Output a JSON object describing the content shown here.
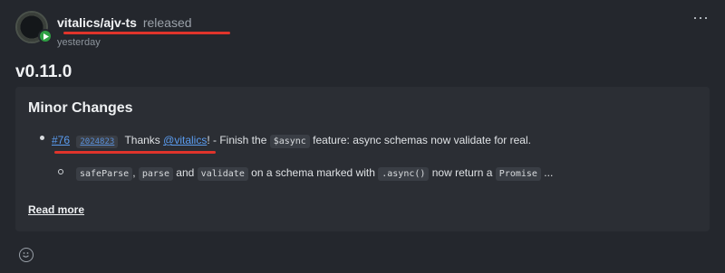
{
  "release": {
    "repo": "vitalics/ajv-ts",
    "action": "released",
    "time": "yesterday",
    "version": "v0.11.0"
  },
  "changelog": {
    "section_title": "Minor Changes",
    "item": {
      "pr": "#76",
      "commit": "2024823",
      "thanks": "Thanks",
      "author": "@vitalics",
      "exclaim": "!",
      "text1": " - Finish the ",
      "code1": "$async",
      "text2": " feature: async schemas now validate for real."
    },
    "subitem": {
      "code1": "safeParse",
      "sep1": ", ",
      "code2": "parse",
      "and": " and ",
      "code3": "validate",
      "text1": " on a schema marked with ",
      "code4": ".async()",
      "text2": " now return a ",
      "code5": "Promise",
      "ellipsis": " ..."
    }
  },
  "actions": {
    "read_more": "Read more",
    "more_icon": "⋯"
  },
  "icons": {
    "avatar_badge": "play-badge-icon",
    "more": "more-horizontal-icon",
    "reaction": "smiley-icon"
  },
  "colors": {
    "link": "#5a9cf0",
    "badge": "#2ea043",
    "annotation": "#e0342b"
  }
}
